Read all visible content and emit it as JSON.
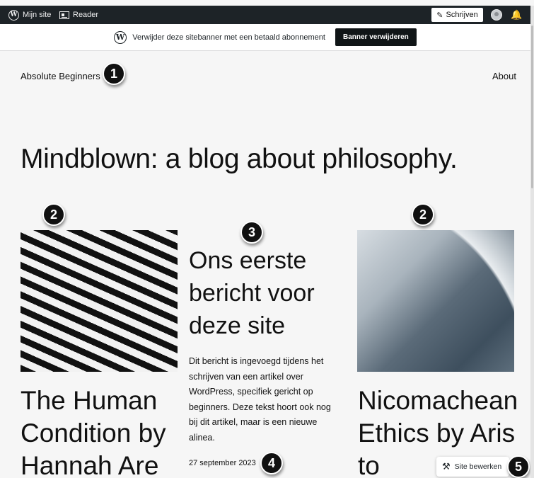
{
  "adminbar": {
    "my_site": "Mijn site",
    "reader": "Reader",
    "write": "Schrijven"
  },
  "banner": {
    "text": "Verwijder deze sitebanner met een betaald abonnement",
    "button": "Banner verwijderen"
  },
  "site": {
    "title": "Absolute Beginners",
    "nav_about": "About",
    "tagline": "Mindblown: a blog about philosophy."
  },
  "posts": [
    {
      "title": "The Human Condition by Hannah Are"
    },
    {
      "title": "Ons eerste bericht voor deze site",
      "excerpt": "Dit bericht is ingevoegd tijdens het schrijven van een artikel over WordPress, specifiek gericht op beginners. Deze tekst hoort ook nog bij dit artikel, maar is een nieuwe alinea.",
      "date": "27 september 2023"
    },
    {
      "title": "Nicomachean Ethics by Aristo"
    }
  ],
  "edit_site": {
    "label": "Site bewerken"
  },
  "callouts": [
    "1",
    "2",
    "3",
    "2",
    "4",
    "5"
  ],
  "icons": [
    "wordpress-logo-icon",
    "reader-icon",
    "pen-icon",
    "avatar-icon",
    "notification-icon",
    "tools-icon"
  ]
}
